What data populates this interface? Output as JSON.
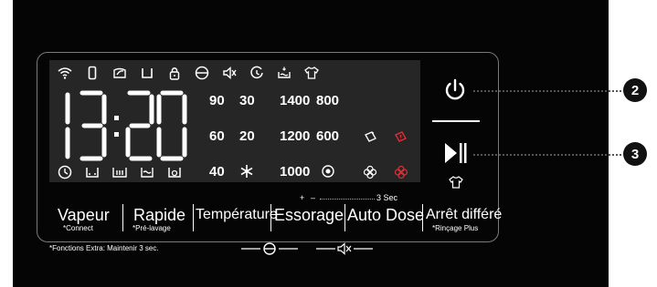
{
  "display": {
    "time": "13:20",
    "temperatures": [
      "90",
      "30",
      "60",
      "20",
      "40"
    ],
    "spins": [
      "1400",
      "800",
      "1200",
      "600",
      "1000"
    ]
  },
  "top_icons": [
    "wifi-icon",
    "phone-icon",
    "eco-icon",
    "basket-icon",
    "lock-icon",
    "drum-icon",
    "mute-icon",
    "timer-icon",
    "tub-icon",
    "shirt-icon"
  ],
  "bottom_icons": [
    "clock-icon",
    "drum-low-icon",
    "drum-high-icon",
    "tub-wave-icon",
    "tub-steam-icon"
  ],
  "buttons": {
    "vapeur": "Vapeur",
    "vapeur_sub": "*Connect",
    "rapide": "Rapide",
    "rapide_sub": "*Pré-lavage",
    "temperature": "Température",
    "essorage": "Essorage",
    "auto_dose": "Auto Dose",
    "arret": "Arrêt différé",
    "arret_sub": "*Rinçage Plus",
    "hint_plus": "+",
    "hint_minus": "–",
    "hint_sec": "3 Sec"
  },
  "footer": {
    "note": "*Fonctions Extra: Maintenir 3 sec."
  },
  "callouts": [
    "2",
    "3"
  ],
  "colors": {
    "accent_red": "#e0303a",
    "panel": "#050505",
    "display": "#262626",
    "text": "#ffffff"
  }
}
